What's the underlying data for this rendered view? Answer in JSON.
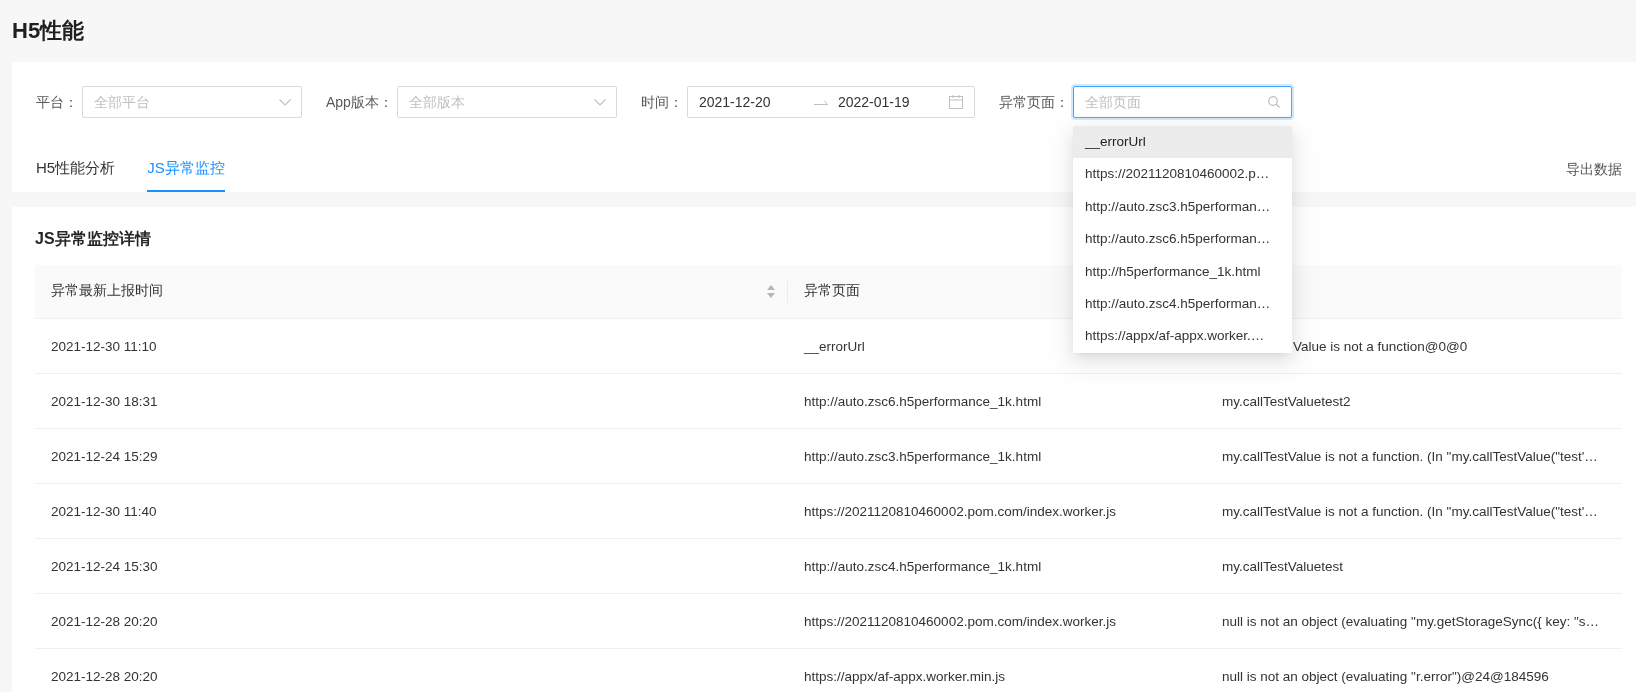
{
  "page": {
    "title": "H5性能"
  },
  "filters": [
    {
      "kind": "select",
      "label": "平台：",
      "placeholder": "全部平台"
    },
    {
      "kind": "select",
      "label": "App版本：",
      "placeholder": "全部版本"
    },
    {
      "kind": "date_range",
      "label": "时间：",
      "start": "2021-12-20",
      "end": "2022-01-19"
    },
    {
      "kind": "search_select",
      "label": "异常页面：",
      "placeholder": "全部页面",
      "focused": true,
      "open": true,
      "options": [
        {
          "label": "__errorUrl",
          "selected": true
        },
        {
          "label": "https://2021120810460002.p…",
          "selected": false
        },
        {
          "label": "http://auto.zsc3.h5performan…",
          "selected": false
        },
        {
          "label": "http://auto.zsc6.h5performan…",
          "selected": false
        },
        {
          "label": "http://h5performance_1k.html",
          "selected": false
        },
        {
          "label": "http://auto.zsc4.h5performan…",
          "selected": false
        },
        {
          "label": "https://appx/af-appx.worker.…",
          "selected": false
        }
      ]
    }
  ],
  "tabs": [
    {
      "label": "H5性能分析",
      "selected": false
    },
    {
      "label": "JS异常监控",
      "selected": true
    }
  ],
  "export_link": "导出数据",
  "detail": {
    "title": "JS异常监控详情",
    "columns": [
      {
        "label": "异常最新上报时间",
        "sortable": true
      },
      {
        "label": "异常页面",
        "sortable": false
      }
    ],
    "rows": [
      {
        "time": "2021-12-30 11:10",
        "page": "__errorUrl",
        "message": "Value is not a function@0@0",
        "covered": true
      },
      {
        "time": "2021-12-30 18:31",
        "page": "http://auto.zsc6.h5performance_1k.html",
        "message": "my.callTestValuetest2",
        "covered": false
      },
      {
        "time": "2021-12-24 15:29",
        "page": "http://auto.zsc3.h5performance_1k.html",
        "message": "my.callTestValue is not a function. (In \"my.callTestValue(\"test'…",
        "covered": false
      },
      {
        "time": "2021-12-30 11:40",
        "page": "https://2021120810460002.pom.com/index.worker.js",
        "message": "my.callTestValue is not a function. (In \"my.callTestValue(\"test'…",
        "covered": false
      },
      {
        "time": "2021-12-24 15:30",
        "page": "http://auto.zsc4.h5performance_1k.html",
        "message": "my.callTestValuetest",
        "covered": false
      },
      {
        "time": "2021-12-28 20:20",
        "page": "https://2021120810460002.pom.com/index.worker.js",
        "message": "null is not an object (evaluating \"my.getStorageSync({ key: \"s…",
        "covered": false
      },
      {
        "time": "2021-12-28 20:20",
        "page": "https://appx/af-appx.worker.min.js",
        "message": "null is not an object (evaluating \"r.error\")@24@184596",
        "covered": false
      }
    ]
  }
}
